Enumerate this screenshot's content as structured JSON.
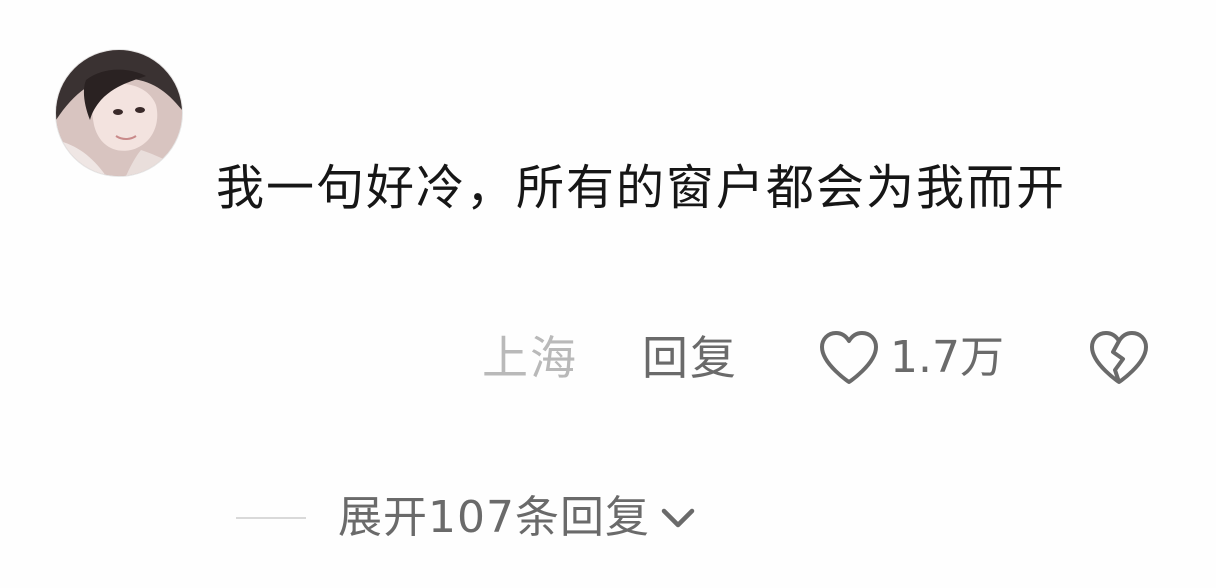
{
  "comment": {
    "avatar_icon": "user-avatar-photo",
    "text": "我一句好冷，所有的窗户都会为我而开",
    "location": "上海",
    "reply_label": "回复",
    "like_count": "1.7万",
    "like_icon": "heart-outline-icon",
    "dislike_icon": "broken-heart-icon"
  },
  "replies": {
    "expand_label": "展开107条回复",
    "expand_icon": "chevron-down-icon"
  },
  "colors": {
    "text_primary": "#161616",
    "text_secondary": "#6a6a6a",
    "text_muted": "#b9b9b9",
    "divider": "#d9d9d9",
    "background": "#fefefe"
  }
}
